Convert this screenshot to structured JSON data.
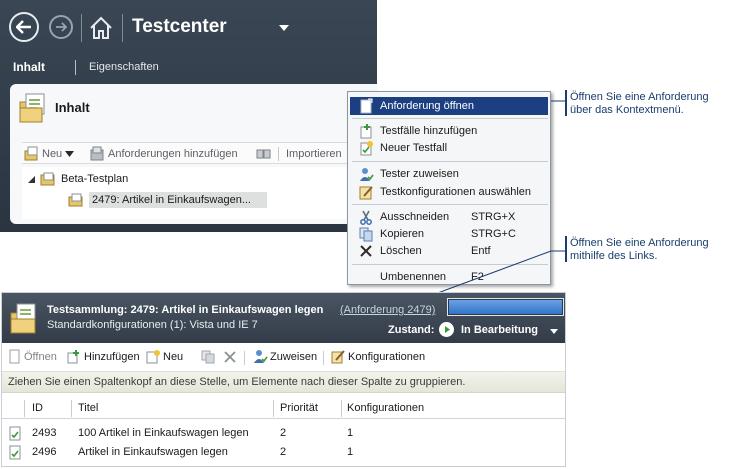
{
  "nav": {
    "app_title": "Testcenter"
  },
  "tabs": {
    "inhalt": "Inhalt",
    "eigenschaften": "Eigenschaften"
  },
  "content_card": {
    "title": "Inhalt",
    "toolbar": {
      "new_label": "Neu",
      "add_requirements_label": "Anforderungen hinzufügen",
      "import_label": "Importieren"
    },
    "tree": {
      "root_label": "Beta-Testplan",
      "child_label": "2479: Artikel in Einkaufswagen..."
    }
  },
  "context_menu": {
    "items": [
      {
        "label": "Anforderung öffnen",
        "icon": "open-requirement-icon",
        "shortcut": ""
      },
      {
        "label": "Testfälle hinzufügen",
        "icon": "add-testcases-icon",
        "shortcut": ""
      },
      {
        "label": "Neuer Testfall",
        "icon": "new-testcase-icon",
        "shortcut": ""
      },
      {
        "label": "Tester zuweisen",
        "icon": "assign-tester-icon",
        "shortcut": ""
      },
      {
        "label": "Testkonfigurationen auswählen",
        "icon": "select-configurations-icon",
        "shortcut": ""
      },
      {
        "label": "Ausschneiden",
        "icon": "cut-icon",
        "shortcut": "STRG+X"
      },
      {
        "label": "Kopieren",
        "icon": "copy-icon",
        "shortcut": "STRG+C"
      },
      {
        "label": "Löschen",
        "icon": "delete-icon",
        "shortcut": "Entf"
      },
      {
        "label": "Umbenennen",
        "icon": "",
        "shortcut": "F2"
      }
    ]
  },
  "callouts": {
    "context_menu": [
      "Öffnen Sie eine Anforderung",
      "über das Kontextmenü."
    ],
    "link": [
      "Öffnen Sie eine Anforderung",
      "mithilfe des Links."
    ]
  },
  "suite": {
    "title": "Testsammlung: 2479: Artikel in Einkaufswagen legen",
    "link": "(Anforderung 2479)",
    "subtitle": "Standardkonfigurationen (1): Vista und IE 7",
    "state_label": "Zustand:",
    "state_value": "In Bearbeitung",
    "progress_fraction": 1.0
  },
  "grid_toolbar": {
    "open_label": "Öffnen",
    "add_label": "Hinzufügen",
    "new_label": "Neu",
    "assign_label": "Zuweisen",
    "configurations_label": "Konfigurationen"
  },
  "grid": {
    "group_hint": "Ziehen Sie einen Spaltenkopf an diese Stelle, um Elemente nach dieser Spalte zu gruppieren.",
    "columns": [
      "ID",
      "Titel",
      "Priorität",
      "Konfigurationen"
    ],
    "rows": [
      {
        "id": "2493",
        "title": "100 Artikel in Einkaufswagen legen",
        "priority": "2",
        "configurations": "1"
      },
      {
        "id": "2496",
        "title": "Artikel in Einkaufswagen legen",
        "priority": "2",
        "configurations": "1"
      }
    ]
  },
  "colors": {
    "accent": "#1c3f82",
    "header_dark": "#333c48",
    "callout": "#1a3d6e"
  }
}
